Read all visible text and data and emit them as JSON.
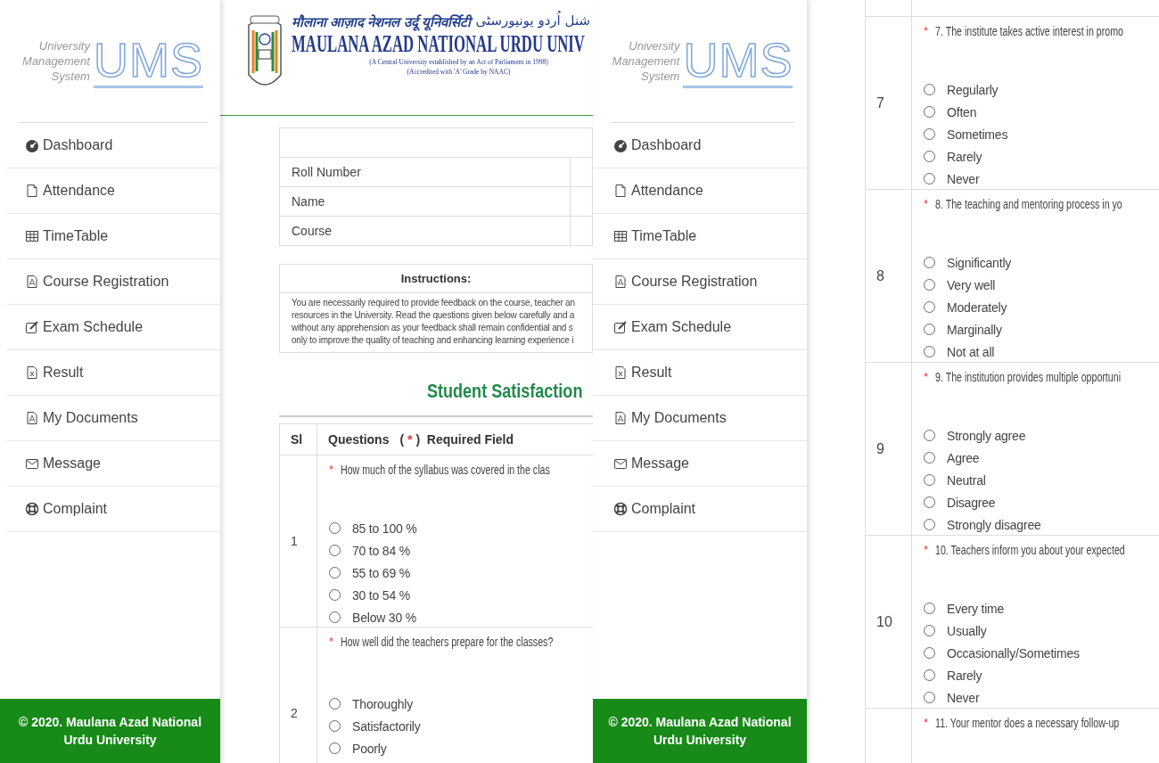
{
  "left_sidebar": {
    "logo": {
      "caption_lines": [
        "University",
        "Management",
        "System"
      ],
      "wordmark": "UMS"
    },
    "items": [
      {
        "label": "Dashboard"
      },
      {
        "label": "Attendance"
      },
      {
        "label": "TimeTable"
      },
      {
        "label": "Course Registration"
      },
      {
        "label": "Exam Schedule"
      },
      {
        "label": "Result"
      },
      {
        "label": "My Documents"
      },
      {
        "label": "Message"
      },
      {
        "label": "Complaint"
      }
    ],
    "footer": "© 2020. Maulana Azad National Urdu University"
  },
  "main": {
    "header": {
      "hindi_name": "मौलाना आज़ाद नेशनल उर्दू यूनिवर्सिटी",
      "urdu_name": "شنل اُردو یونیورسٹی",
      "english_name": "MAULANA AZAD NATIONAL URDU UNIV",
      "subtitle_lines": [
        "(A Central University established by an Act of Parliament in 1998)",
        "(Accredited with 'A' Grade by NAAC)"
      ]
    },
    "student_table": {
      "rows": [
        {
          "label": "Roll Number"
        },
        {
          "label": "Name"
        },
        {
          "label": "Course"
        }
      ]
    },
    "instructions": {
      "title": "Instructions:",
      "lines": [
        "You are necessarily required to provide feedback on the course, teacher an",
        "resources in the University.  Read the questions given below carefully and a",
        "without any apprehension as your feedback shall remain confidential and s",
        "only to improve the quality of teaching and enhancing learning experience i"
      ]
    },
    "survey_title": "Student Satisfaction",
    "questions_table": {
      "columns": [
        "Sl",
        "Questions"
      ],
      "legend": {
        "open": "(",
        "mark": "*",
        "close": ")",
        "label": "Required Field"
      },
      "questions": [
        {
          "sl": "1",
          "mark": "*",
          "text": "How much of the syllabus was covered in the clas",
          "options": [
            {
              "label": "85 to 100 %",
              "selected": false
            },
            {
              "label": "70 to 84 %",
              "selected": false
            },
            {
              "label": "55 to 69 %",
              "selected": false
            },
            {
              "label": "30 to 54 %",
              "selected": false
            },
            {
              "label": "Below 30 %",
              "selected": false
            }
          ]
        },
        {
          "sl": "2",
          "mark": "*",
          "text": "How well did the teachers prepare for the classes?",
          "options": [
            {
              "label": "Thoroughly",
              "selected": false
            },
            {
              "label": "Satisfactorily",
              "selected": false
            },
            {
              "label": "Poorly",
              "selected": false
            }
          ]
        }
      ]
    }
  },
  "middle_sidebar": {
    "logo": {
      "caption_lines": [
        "University",
        "Management",
        "System"
      ],
      "wordmark": "UMS"
    },
    "items": [
      {
        "label": "Dashboard"
      },
      {
        "label": "Attendance"
      },
      {
        "label": "TimeTable"
      },
      {
        "label": "Course Registration"
      },
      {
        "label": "Exam Schedule"
      },
      {
        "label": "Result"
      },
      {
        "label": "My Documents"
      },
      {
        "label": "Message"
      },
      {
        "label": "Complaint"
      }
    ],
    "footer": "© 2020. Maulana Azad National Urdu University"
  },
  "right_form": {
    "questions": [
      {
        "sl": "7",
        "mark": "*",
        "text": "7. The institute takes active interest in promo",
        "options": [
          {
            "label": "Regularly",
            "selected": false
          },
          {
            "label": "Often",
            "selected": false
          },
          {
            "label": "Sometimes",
            "selected": false
          },
          {
            "label": "Rarely",
            "selected": false
          },
          {
            "label": "Never",
            "selected": false
          }
        ]
      },
      {
        "sl": "8",
        "mark": "*",
        "text": "8. The teaching and mentoring process in yo",
        "options": [
          {
            "label": "Significantly",
            "selected": false
          },
          {
            "label": "Very well",
            "selected": false
          },
          {
            "label": "Moderately",
            "selected": false
          },
          {
            "label": "Marginally",
            "selected": false
          },
          {
            "label": "Not at all",
            "selected": false
          }
        ]
      },
      {
        "sl": "9",
        "mark": "*",
        "text": "9. The institution provides multiple opportuni",
        "options": [
          {
            "label": "Strongly agree",
            "selected": false
          },
          {
            "label": "Agree",
            "selected": false
          },
          {
            "label": "Neutral",
            "selected": false
          },
          {
            "label": "Disagree",
            "selected": false
          },
          {
            "label": "Strongly disagree",
            "selected": false
          }
        ]
      },
      {
        "sl": "10",
        "mark": "*",
        "text": "10. Teachers inform you about your expected",
        "options": [
          {
            "label": "Every time",
            "selected": false
          },
          {
            "label": "Usually",
            "selected": false
          },
          {
            "label": "Occasionally/Sometimes",
            "selected": false
          },
          {
            "label": "Rarely",
            "selected": false
          },
          {
            "label": "Never",
            "selected": false
          }
        ]
      },
      {
        "mark": "*",
        "text": "11. Your mentor does a necessary follow-up"
      }
    ]
  }
}
